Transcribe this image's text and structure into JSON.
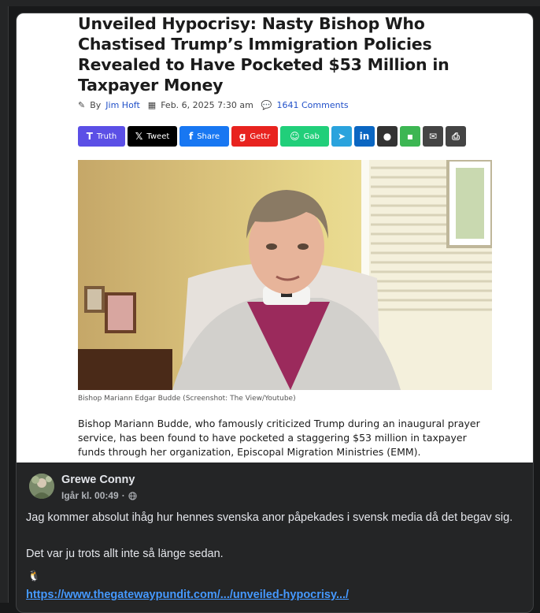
{
  "article": {
    "headline": "Unveiled Hypocrisy: Nasty Bishop Who Chastised Trump’s Immigration Policies Revealed to Have Pocketed $53 Million in Taxpayer Money",
    "by_label": "By",
    "author": "Jim Hoft",
    "date": "Feb. 6, 2025 7:30 am",
    "comments": "1641 Comments",
    "share_buttons": [
      {
        "label": "Truth",
        "icon": "truth-icon",
        "color": "#5b4fe6"
      },
      {
        "label": "Tweet",
        "icon": "x-icon",
        "color": "#000000"
      },
      {
        "label": "Share",
        "icon": "facebook-icon",
        "color": "#1877f2"
      },
      {
        "label": "Gettr",
        "icon": "gettr-icon",
        "color": "#e8231f"
      },
      {
        "label": "Gab",
        "icon": "gab-icon",
        "color": "#21cf7a"
      },
      {
        "label": "",
        "icon": "telegram-icon",
        "color": "#2aa3dd"
      },
      {
        "label": "",
        "icon": "linkedin-icon",
        "color": "#0a66c2"
      },
      {
        "label": "",
        "icon": "comment-icon",
        "color": "#333333"
      },
      {
        "label": "",
        "icon": "sms-icon",
        "color": "#3db653"
      },
      {
        "label": "",
        "icon": "email-icon",
        "color": "#444444"
      },
      {
        "label": "",
        "icon": "print-icon",
        "color": "#444444"
      }
    ],
    "photo_caption": "Bishop Mariann Edgar Budde (Screenshot: The View/Youtube)",
    "body_text": "Bishop Mariann Budde, who famously criticized Trump during an inaugural prayer service, has been found to have pocketed a staggering $53 million in taxpayer funds through her organization, Episcopal Migration Ministries (EMM)."
  },
  "post": {
    "author": "Grewe Conny",
    "time": "Igår kl. 00:49",
    "separator": "·",
    "privacy_icon": "globe-icon",
    "paragraph1": "Jag kommer absolut ihåg hur hennes svenska anor påpekades i svensk media då det begav sig.",
    "paragraph2": "Det var ju trots allt inte så länge sedan.",
    "emoji": "🐧",
    "link": "https://www.thegatewaypundit.com/.../unveiled-hypocrisy.../"
  }
}
